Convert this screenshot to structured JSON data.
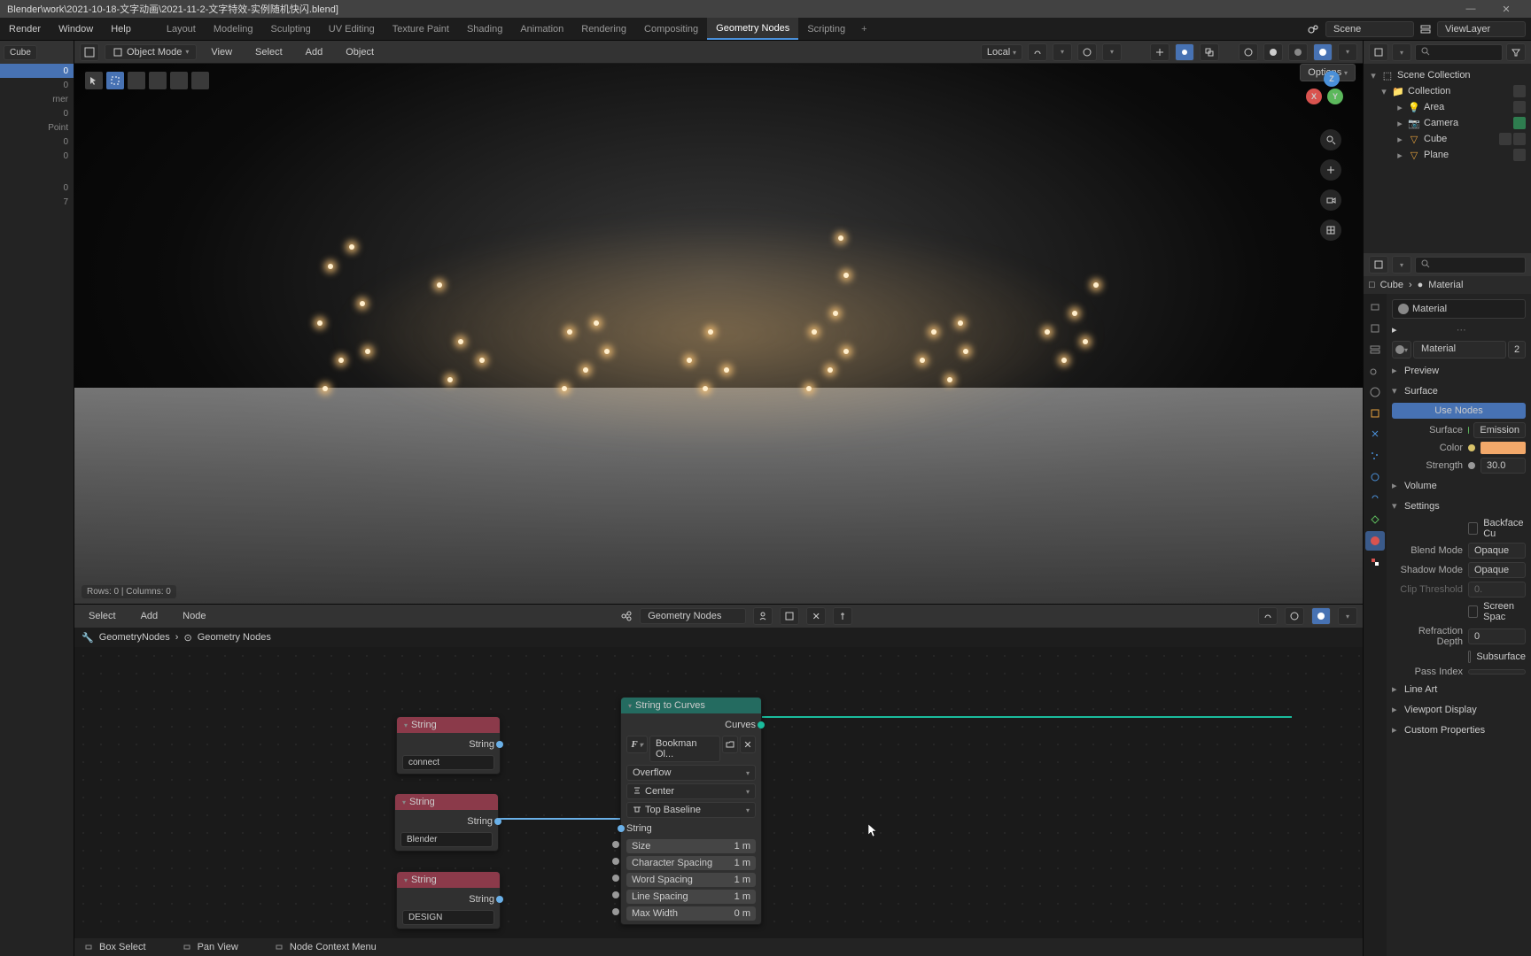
{
  "titlebar": "Blender\\work\\2021-10-18-文字动画\\2021-11-2-文字特效-实例随机快闪.blend]",
  "window_buttons": {
    "min": "—",
    "close": "✕"
  },
  "top_menu": [
    "Render",
    "Window",
    "Help"
  ],
  "workspaces": [
    "Layout",
    "Modeling",
    "Sculpting",
    "UV Editing",
    "Texture Paint",
    "Shading",
    "Animation",
    "Rendering",
    "Compositing",
    "Geometry Nodes",
    "Scripting"
  ],
  "workspace_active": "Geometry Nodes",
  "scene_label": "Scene",
  "viewlayer_label": "ViewLayer",
  "viewport": {
    "object_name": "Cube",
    "mode": "Object Mode",
    "menus": [
      "View",
      "Select",
      "Add",
      "Object"
    ],
    "orientation": "Local",
    "stats": "Rows: 0   |   Columns: 0",
    "options_label": "Options"
  },
  "left_numbers": [
    "0",
    "0",
    "",
    "0",
    "",
    "",
    "",
    "0",
    "",
    "0",
    "",
    "",
    "",
    "0",
    "7"
  ],
  "left_labels": {
    "corner": "rner",
    "point": "Point"
  },
  "node_editor": {
    "menus": [
      "Select",
      "Add",
      "Node"
    ],
    "tree_name": "Geometry Nodes",
    "breadcrumb": [
      "GeometryNodes",
      "Geometry Nodes"
    ],
    "status": [
      "Box Select",
      "Pan View",
      "Node Context Menu"
    ]
  },
  "nodes": {
    "string1": {
      "title": "String",
      "out": "String",
      "value": "connect"
    },
    "string2": {
      "title": "String",
      "out": "String",
      "value": "Blender"
    },
    "string3": {
      "title": "String",
      "out": "String",
      "value": "DESIGN"
    },
    "stc": {
      "title": "String to Curves",
      "out": "Curves",
      "font": "Bookman Ol...",
      "overflow": "Overflow",
      "align_x": "Center",
      "align_y": "Top Baseline",
      "in_string": "String",
      "rows": [
        {
          "label": "Size",
          "value": "1 m"
        },
        {
          "label": "Character Spacing",
          "value": "1 m"
        },
        {
          "label": "Word Spacing",
          "value": "1 m"
        },
        {
          "label": "Line Spacing",
          "value": "1 m"
        },
        {
          "label": "Max Width",
          "value": "0 m"
        }
      ]
    }
  },
  "outliner": {
    "scene_collection": "Scene Collection",
    "collection": "Collection",
    "items": [
      "Area",
      "Camera",
      "Cube",
      "Plane"
    ]
  },
  "properties": {
    "breadcrumb_obj": "Cube",
    "breadcrumb_mat": "Material",
    "material_slot": "Material",
    "material_name": "Material",
    "material_users": "2",
    "sections": {
      "preview": "Preview",
      "surface": "Surface",
      "volume": "Volume",
      "settings": "Settings",
      "lineart": "Line Art",
      "viewport": "Viewport Display",
      "custom": "Custom Properties"
    },
    "use_nodes": "Use Nodes",
    "surface_label": "Surface",
    "surface_value": "Emission",
    "color_label": "Color",
    "color_value": "#f2a86a",
    "strength_label": "Strength",
    "strength_value": "30.0",
    "backface_label": "Backface Cu",
    "blend_mode_label": "Blend Mode",
    "blend_mode_value": "Opaque",
    "shadow_mode_label": "Shadow Mode",
    "shadow_mode_value": "Opaque",
    "clip_label": "Clip Threshold",
    "clip_value": "0.",
    "screenspace_label": "Screen Spac",
    "refraction_label": "Refraction Depth",
    "refraction_value": "0",
    "subsurface_label": "Subsurface",
    "passindex_label": "Pass Index"
  }
}
